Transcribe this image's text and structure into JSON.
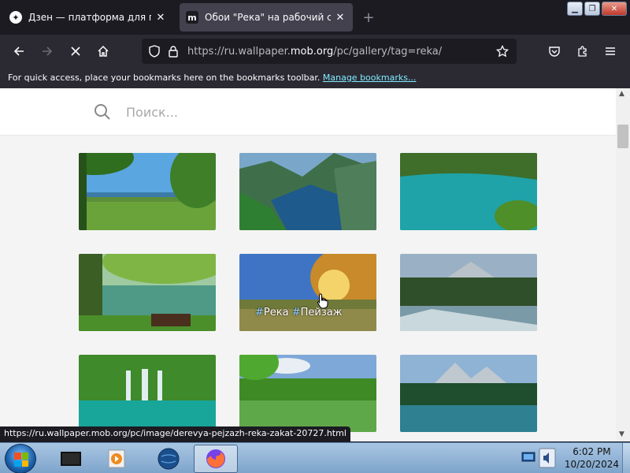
{
  "browser": {
    "tabs": [
      {
        "title": "Дзен — платформа для прос",
        "favicon": "zen-icon",
        "active": false
      },
      {
        "title": "Обои \"Река\" на рабочий стол",
        "favicon": "m",
        "active": true
      }
    ],
    "new_tab": "+",
    "url_prefix": "https://ru.wallpaper.",
    "url_host": "mob.org",
    "url_path": "/pc/gallery/tag=reka/",
    "bookmarks_text": "For quick access, place your bookmarks here on the bookmarks toolbar.",
    "bookmarks_link": "Manage bookmarks..."
  },
  "page": {
    "search_placeholder": "Поиск...",
    "hover_tags": [
      "Река",
      "Пейзаж"
    ],
    "hash": "#"
  },
  "status_url": "https://ru.wallpaper.mob.org/pc/image/derevya-pejzazh-reka-zakat-20727.html",
  "taskbar": {
    "time": "6:02 PM",
    "date": "10/20/2024"
  }
}
